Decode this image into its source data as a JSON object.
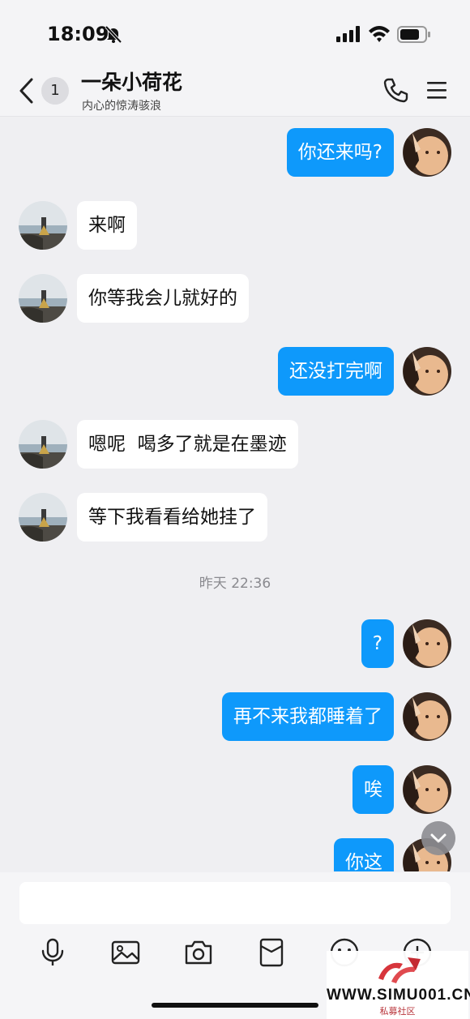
{
  "status_bar": {
    "time": "18:09"
  },
  "header": {
    "unread_count": "1",
    "contact_name": "一朵小荷花",
    "contact_status": "内心的惊涛骇浪"
  },
  "messages": [
    {
      "side": "right",
      "text": "你还来吗?"
    },
    {
      "side": "left",
      "text": "来啊"
    },
    {
      "side": "left",
      "text": "你等我会儿就好的"
    },
    {
      "side": "right",
      "text": "还没打完啊"
    },
    {
      "side": "left",
      "text": "嗯呢  喝多了就是在墨迹"
    },
    {
      "side": "left",
      "text": "等下我看看给她挂了"
    },
    {
      "side": "right",
      "text": "?"
    },
    {
      "side": "right",
      "text": "再不来我都睡着了"
    },
    {
      "side": "right",
      "text": "唉"
    },
    {
      "side": "right",
      "text": "你这"
    }
  ],
  "timestamp": "昨天 22:36",
  "input": {
    "value": ""
  },
  "toolbar": [
    "mic-icon",
    "image-icon",
    "camera-icon",
    "red-packet-icon",
    "emoji-icon",
    "plus-icon"
  ],
  "watermark": {
    "text": "WWW.SIMU001.CN",
    "sub": "私募社区"
  },
  "colors": {
    "outgoing_bubble": "#0e99fb",
    "incoming_bubble": "#ffffff",
    "background": "#efeff2"
  }
}
